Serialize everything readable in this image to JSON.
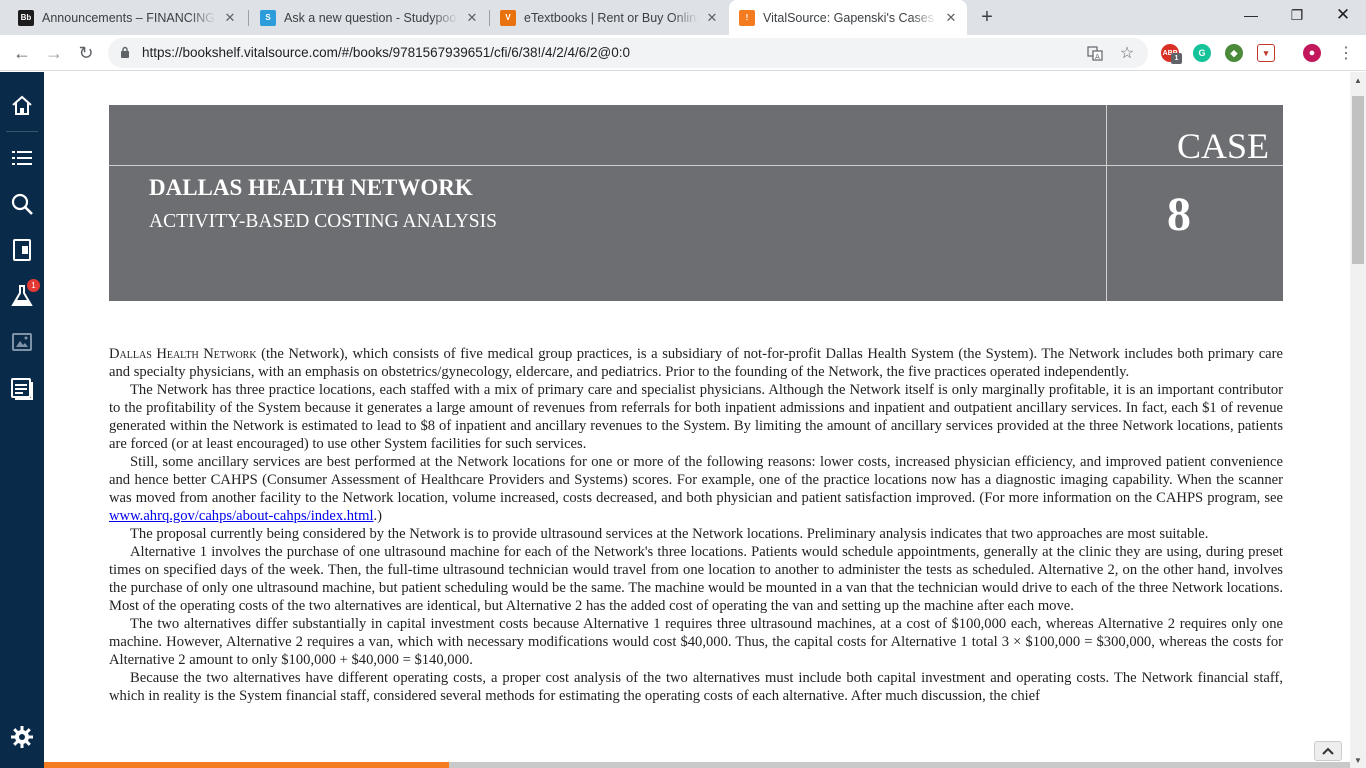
{
  "browser": {
    "tabs": [
      {
        "favicon": "Bb",
        "favicon_color": "#1c1c1c",
        "title": "Announcements – FINANCING A"
      },
      {
        "favicon": "S",
        "favicon_color": "#2d9cdb",
        "title": "Ask a new question - Studypool"
      },
      {
        "favicon": "V",
        "favicon_color": "#e8730e",
        "title": "eTextbooks | Rent or Buy Online"
      },
      {
        "favicon": "!",
        "favicon_color": "#f47b20",
        "title": "VitalSource: Gapenski's Cases in"
      }
    ],
    "url": "https://bookshelf.vitalsource.com/#/books/9781567939651/cfi/6/38!/4/2/4/6/2@0:0",
    "extension_badge": "1"
  },
  "sidebar": {
    "items": [
      "home-icon",
      "toc-icon",
      "search-icon",
      "flashcards-icon",
      "lab-icon",
      "figures-icon",
      "notebook-icon"
    ],
    "lab_badge": "1",
    "settings": "settings-icon"
  },
  "header": {
    "case_label": "CASE",
    "case_number": "8",
    "title": "DALLAS HEALTH NETWORK",
    "subtitle": "ACTIVITY-BASED COSTING ANALYSIS"
  },
  "content": {
    "p1_sc": "Dallas Health Network",
    "p1": " (the Network), which consists of five medical group practices, is a subsidiary of not-for-profit Dallas Health System (the System). The Network includes both primary care and specialty physicians, with an emphasis on obstetrics/gynecology, eldercare, and pediatrics. Prior to the founding of the Network, the five practices operated independently.",
    "p2": "The Network has three practice locations, each staffed with a mix of primary care and specialist physicians. Although the Network itself is only marginally profitable, it is an important contributor to the profitability of the System because it generates a large amount of revenues from referrals for both inpatient admissions and inpatient and outpatient ancillary services. In fact, each $1 of revenue generated within the Network is estimated to lead to $8 of inpatient and ancillary revenues to the System. By limiting the amount of ancillary services provided at the three Network locations, patients are forced (or at least encouraged) to use other System facilities for such services.",
    "p3": "Still, some ancillary services are best performed at the Network locations for one or more of the following reasons: lower costs, increased physician efficiency, and improved patient convenience and hence better CAHPS (Consumer Assessment of Healthcare Providers and Systems) scores. For example, one of the practice locations now has a diagnostic imaging capability. When the scanner was moved from another facility to the Network location, volume increased, costs decreased, and both physician and patient satisfaction improved. (For more information on the CAHPS program, see ",
    "p3_link": "www.ahrq.gov/cahps/about-cahps/index.html",
    "p3_end": ".)",
    "p4": "The proposal currently being considered by the Network is to provide ultrasound services at the Network locations. Preliminary analysis indicates that two approaches are most suitable.",
    "p5": "Alternative 1 involves the purchase of one ultrasound machine for each of the Network's three locations. Patients would schedule appointments, generally at the clinic they are using, during preset times on specified days of the week. Then, the full-time ultrasound technician would travel from one location to another to administer the tests as scheduled. Alternative 2, on the other hand, involves the purchase of only one ultrasound machine, but patient scheduling would be the same. The machine would be mounted in a van that the technician would drive to each of the three Network locations. Most of the operating costs of the two alternatives are identical, but Alternative 2 has the added cost of operating the van and setting up the machine after each move.",
    "p6": "The two alternatives differ substantially in capital investment costs because Alternative 1 requires three ultrasound machines, at a cost of $100,000 each, whereas Alternative 2 requires only one machine. However, Alternative 2 requires a van, which with necessary modifications would cost $40,000. Thus, the capital costs for Alternative 1 total 3 × $100,000 = $300,000, whereas the costs for Alternative 2 amount to only $100,000 + $40,000 = $140,000.",
    "p7": "Because the two alternatives have different operating costs, a proper cost analysis of the two alternatives must include both capital investment and operating costs. The Network financial staff, which in reality is the System financial staff, considered several methods for estimating the operating costs of each alternative. After much discussion, the chief"
  },
  "reading_progress": 0.31,
  "colors": {
    "sidebar": "#0a2a4a",
    "header_box": "#6d6e71",
    "progress": "#f47b20"
  }
}
